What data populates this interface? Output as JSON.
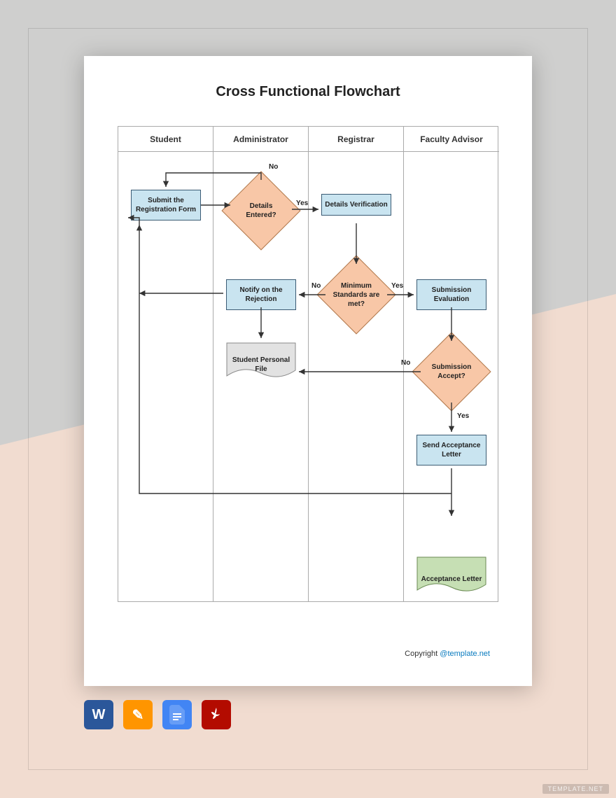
{
  "title": "Cross Functional Flowchart",
  "lanes": [
    "Student",
    "Administrator",
    "Registrar",
    "Faculty Advisor"
  ],
  "nodes": {
    "submit": "Submit the Registration Form",
    "detailsEntered": "Details Entered?",
    "detailsVerification": "Details Verification",
    "minStandards": "Minimum Standards are met?",
    "notifyRejection": "Notify on the Rejection",
    "studentFile": "Student Personal File",
    "submissionEval": "Submission Evaluation",
    "submissionAccept": "Submission Accept?",
    "sendAcceptance": "Send Acceptance Letter",
    "acceptanceLetter": "Acceptance Letter"
  },
  "edgeLabels": {
    "yes": "Yes",
    "no": "No"
  },
  "copyright": {
    "prefix": "Copyright ",
    "link": "@template.net"
  },
  "fileFormats": [
    "word",
    "pages",
    "gdoc",
    "pdf"
  ],
  "watermark": "TEMPLATE.NET"
}
